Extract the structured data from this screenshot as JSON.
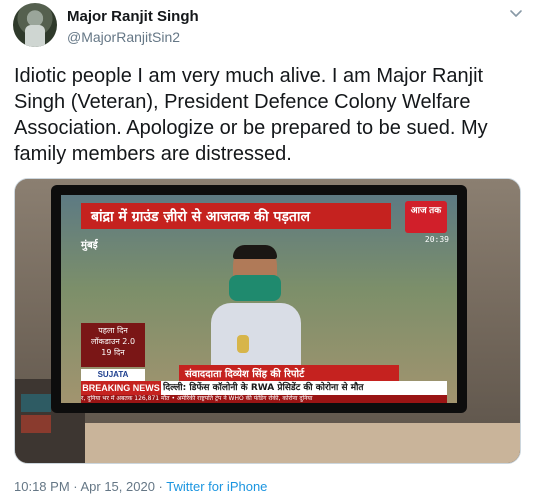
{
  "author": {
    "name": "Major Ranjit Singh",
    "handle": "@MajorRanjitSin2"
  },
  "tweet": {
    "text": "Idiotic people I am very much alive. I am Major Ranjit Singh (Veteran), President Defence Colony Welfare Association. Apologize or be prepared to be sued. My family members are distressed."
  },
  "media": {
    "tv_headline": "बांद्रा में ग्राउंड ज़ीरो से आजतक की पड़ताल",
    "channel_logo": "आज तक",
    "channel_time": "20:39",
    "city": "मुंबई",
    "lockdown_line1": "पहला दिन",
    "lockdown_line2": "लॉकडाउन 2.0",
    "lockdown_line3": "19 दिन",
    "sponsor": "SUJATA",
    "reporter_strap": "संवाददाता दिव्येश सिंह की रिपोर्ट",
    "breaking_label": "BREAKING NEWS",
    "breaking_text": "दिल्ली: डिफेंस कॉलोनी के RWA प्रेसिडेंट की कोरोना से मौत",
    "ticker_text": "र, दुनिया भर में अबतक 126,871 मौत • अमेरिकी राष्ट्रपति ट्रंप ने WHO की फंडिंग रोकी, कोरोना दुनिया"
  },
  "meta": {
    "timestamp": "10:18 PM · Apr 15, 2020 · ",
    "source": "Twitter for iPhone"
  },
  "colors": {
    "name_text": "#14171a",
    "secondary_text": "#657786",
    "link": "#1b95e0",
    "news_red": "#c5221f"
  },
  "icons": {
    "caret": "chevron-down-icon"
  }
}
